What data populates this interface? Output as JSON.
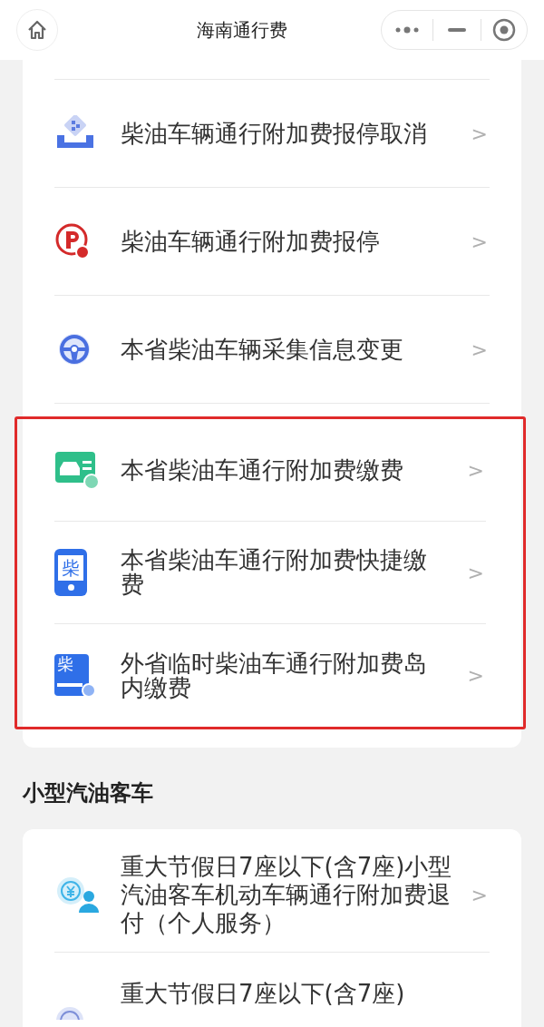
{
  "nav_bar": {
    "title": "海南通行费"
  },
  "diesel_section": {
    "items": [
      {
        "kind": "tray",
        "label": "柴油车辆通行附加费报停取消",
        "chevron": ">"
      },
      {
        "kind": "parking",
        "label": "柴油车辆通行附加费报停",
        "chevron": ">"
      },
      {
        "kind": "wheel",
        "label": "本省柴油车辆采集信息变更",
        "chevron": ">"
      }
    ],
    "highlighted_items": [
      {
        "kind": "car_card",
        "label": "本省柴油车通行附加费缴费",
        "chevron": ">"
      },
      {
        "kind": "phone",
        "icon_text": "柴",
        "label": "本省柴油车通行附加费快捷缴费",
        "chevron": ">"
      },
      {
        "kind": "document",
        "icon_text": "柴",
        "label": "外省临时柴油车通行附加费岛内缴费",
        "chevron": ">"
      }
    ]
  },
  "petrol_section": {
    "title": "小型汽油客车",
    "items": [
      {
        "kind": "refund",
        "label": "重大节假日7座以下(含7座)小型汽油客车机动车辆通行附加费退付（个人服务）",
        "chevron": ">"
      },
      {
        "kind": "refund_partial",
        "label": "重大节假日7座以下(含7座)"
      }
    ]
  }
}
